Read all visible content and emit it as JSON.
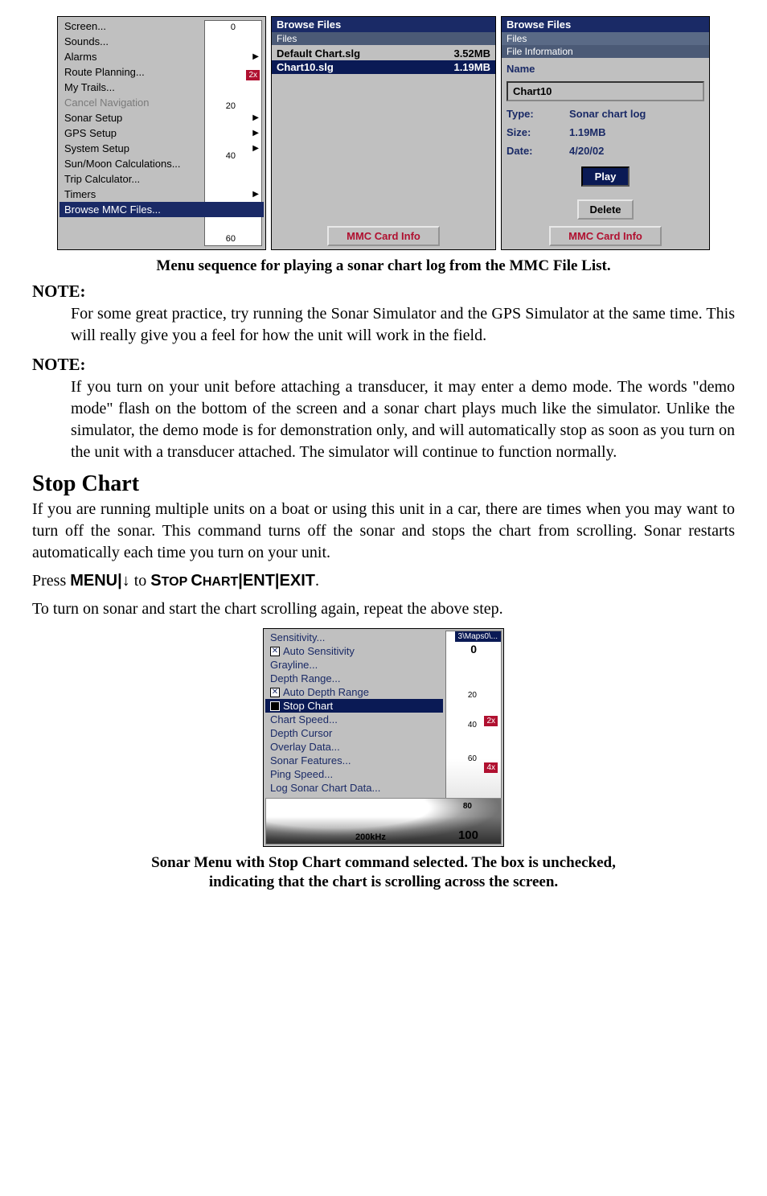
{
  "menu1": {
    "items": [
      {
        "label": "Screen...",
        "arrow": false
      },
      {
        "label": "Sounds...",
        "arrow": false
      },
      {
        "label": "Alarms",
        "arrow": true
      },
      {
        "label": "Route Planning...",
        "arrow": false
      },
      {
        "label": "My Trails...",
        "arrow": false
      },
      {
        "label": "Cancel Navigation",
        "arrow": false,
        "disabled": true
      },
      {
        "label": "Sonar Setup",
        "arrow": true
      },
      {
        "label": "GPS Setup",
        "arrow": true
      },
      {
        "label": "System Setup",
        "arrow": true
      },
      {
        "label": "Sun/Moon Calculations...",
        "arrow": false
      },
      {
        "label": "Trip Calculator...",
        "arrow": false
      },
      {
        "label": "Timers",
        "arrow": true
      },
      {
        "label": "Browse MMC Files...",
        "arrow": false,
        "selected": true
      }
    ],
    "ticks": {
      "t0": "0",
      "t20": "20",
      "t40": "40",
      "t60": "60"
    },
    "scale": "2x"
  },
  "browse": {
    "title": "Browse Files",
    "files_label": "Files",
    "rows": [
      {
        "name": "Default Chart.slg",
        "size": "3.52MB",
        "selected": false
      },
      {
        "name": "Chart10.slg",
        "size": "1.19MB",
        "selected": true
      }
    ],
    "button": "MMC Card Info"
  },
  "info": {
    "title": "Browse Files",
    "files_label": "Files",
    "section": "File Information",
    "name_label": "Name",
    "name_value": "Chart10",
    "rows": [
      {
        "label": "Type:",
        "value": "Sonar chart log"
      },
      {
        "label": "Size:",
        "value": "1.19MB"
      },
      {
        "label": "Date:",
        "value": "4/20/02"
      }
    ],
    "play": "Play",
    "delete": "Delete",
    "card": "MMC Card Info"
  },
  "caption1": "Menu sequence for playing a sonar chart log from the MMC File List.",
  "note_label": "NOTE:",
  "note1": "For some great practice, try running the Sonar Simulator and the GPS Simulator at the same time. This will really give you a feel for how the unit will work in the field.",
  "note2": "If you turn on your unit before attaching a transducer, it may enter a demo mode. The words \"demo mode\" flash on the bottom of the screen and a sonar chart plays much like the simulator. Unlike the simulator, the demo mode is for demonstration only, and will auto­matically stop as soon as you turn on the unit with a transducer at­tached. The simulator will continue to function normally.",
  "section_title": "Stop Chart",
  "body1": "If you are running multiple units on a boat or using this unit in a car, there are times when you may want to turn off the sonar. This com­mand turns off the sonar and stops the chart from scrolling. Sonar re­starts automatically each time you turn on your unit.",
  "cmd": {
    "press": "Press ",
    "menu": "MENU",
    "sep1": "|",
    "arrow": "↓",
    "to": " to ",
    "stop": "STOP CHART",
    "sep2": "|",
    "ent": "ENT",
    "sep3": "|",
    "exit": "EXIT",
    "period": "."
  },
  "body2": "To turn on sonar and start the chart scrolling again, repeat the above step.",
  "sonarMenu": {
    "items": [
      {
        "label": "Sensitivity...",
        "cb": null
      },
      {
        "label": "Auto Sensitivity",
        "cb": "x"
      },
      {
        "label": "Grayline...",
        "cb": null
      },
      {
        "label": "Depth Range...",
        "cb": null
      },
      {
        "label": "Auto Depth Range",
        "cb": "x"
      },
      {
        "label": "Stop Chart",
        "cb": "empty",
        "selected": true
      },
      {
        "label": "Chart Speed...",
        "cb": null
      },
      {
        "label": "Depth Cursor",
        "cb": null
      },
      {
        "label": "Overlay Data...",
        "cb": null
      },
      {
        "label": "Sonar Features...",
        "cb": null
      },
      {
        "label": "Ping Speed...",
        "cb": null
      },
      {
        "label": "Log Sonar Chart Data...",
        "cb": null
      }
    ],
    "maps": "3\\Maps0\\...",
    "ticks": {
      "t0": "0",
      "t20": "20",
      "t40": "40",
      "t60": "60",
      "t80": "80",
      "t100": "100"
    },
    "khz": "200kHz",
    "scale2": "2x",
    "scale4": "4x"
  },
  "caption2a": "Sonar Menu with Stop Chart command selected. The box is unchecked,",
  "caption2b": "indicating that the chart is scrolling across the screen."
}
